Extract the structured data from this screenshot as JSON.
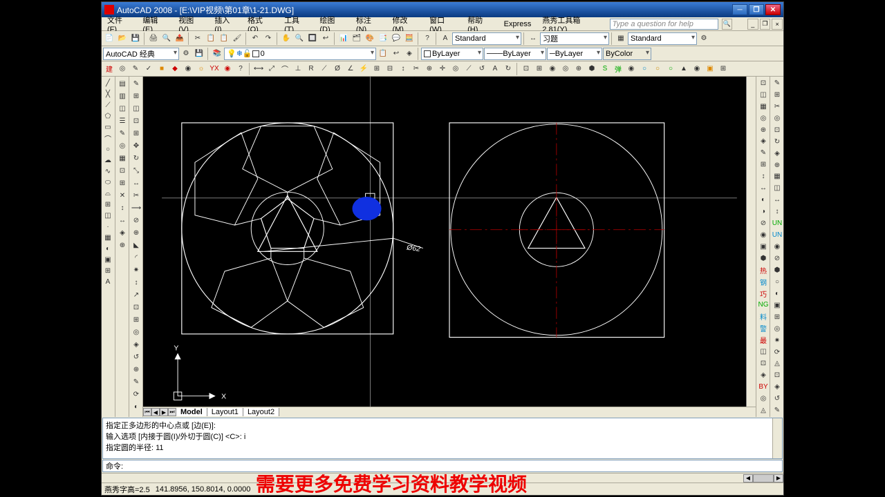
{
  "title": "AutoCAD 2008 - [E:\\VIP视频\\第01章\\1-21.DWG]",
  "menu": [
    "文件(F)",
    "编辑(E)",
    "视图(V)",
    "插入(I)",
    "格式(O)",
    "工具(T)",
    "绘图(D)",
    "标注(N)",
    "修改(M)",
    "窗口(W)",
    "帮助(H)",
    "Express",
    "燕秀工具箱2.81(Y)"
  ],
  "help_placeholder": "Type a question for help",
  "workspace": "AutoCAD 经典",
  "layer_current": "0",
  "linetype": "ByLayer",
  "lineweight": "ByLayer",
  "plotstyle": "ByColor",
  "textstyle": "Standard",
  "dimstyle": "习题",
  "tablestyle": "Standard",
  "tabs": {
    "model": "Model",
    "layouts": [
      "Layout1",
      "Layout2"
    ]
  },
  "cmd_lines": [
    "指定正多边形的中心点或 [边(E)]:",
    "输入选项 [内接于圆(I)/外切于圆(C)] <C>: i",
    "指定圆的半径: 11"
  ],
  "cmd_prompt": "命令:",
  "status_left": "燕秀字高=2.5",
  "coords": "141.8956, 150.8014, 0.0000",
  "dim_label_1": "Ø62",
  "banner": "需要更多免费学习资料教学视频",
  "ucs": {
    "x": "X",
    "y": "Y"
  }
}
